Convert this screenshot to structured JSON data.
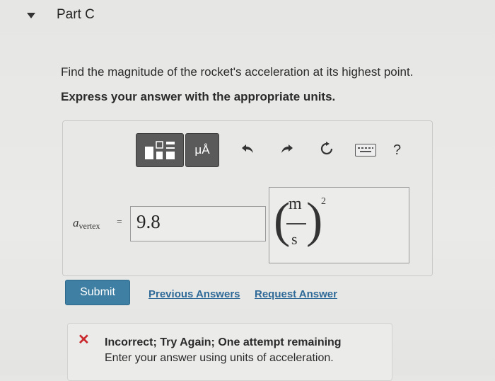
{
  "part": {
    "title": "Part C"
  },
  "question": {
    "text": "Find the magnitude of the rocket's acceleration at its highest point.",
    "instruction": "Express your answer with the appropriate units."
  },
  "toolbar": {
    "units_label": "μÅ",
    "undo_icon": "undo-arrow-icon",
    "redo_icon": "redo-arrow-icon",
    "reset_icon": "reset-icon",
    "keyboard_icon": "keyboard-icon",
    "help_label": "?"
  },
  "answer": {
    "variable": "a",
    "variable_sub": "vertex",
    "equals": "=",
    "value": "9.8",
    "unit_numerator": "m",
    "unit_denominator": "s",
    "unit_exponent": "2"
  },
  "actions": {
    "submit_label": "Submit",
    "previous_answers_label": "Previous Answers",
    "request_answer_label": "Request Answer"
  },
  "feedback": {
    "title": "Incorrect; Try Again; One attempt remaining",
    "message": "Enter your answer using units of acceleration.",
    "status_color": "#c9282d"
  }
}
